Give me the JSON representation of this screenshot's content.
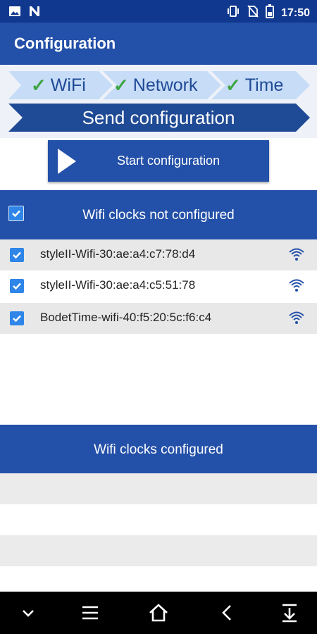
{
  "status_bar": {
    "time": "17:50",
    "icons": [
      "image-icon",
      "n-notification-icon",
      "vibrate-icon",
      "no-sim-icon",
      "battery-icon"
    ]
  },
  "app_bar": {
    "title": "Configuration"
  },
  "steps": [
    {
      "label": "WiFi",
      "done": true
    },
    {
      "label": "Network",
      "done": true
    },
    {
      "label": "Time",
      "done": true
    }
  ],
  "current_step": {
    "label": "Send configuration"
  },
  "start_button": {
    "label": "Start configuration"
  },
  "not_configured": {
    "header": "Wifi clocks not configured",
    "header_checked": true,
    "items": [
      {
        "name": "styleII-Wifi-30:ae:a4:c7:78:d4",
        "checked": true
      },
      {
        "name": "styleII-Wifi-30:ae:a4:c5:51:78",
        "checked": true
      },
      {
        "name": "BodetTime-wifi-40:f5:20:5c:f6:c4",
        "checked": true
      }
    ]
  },
  "configured": {
    "header": "Wifi clocks configured",
    "items": []
  },
  "nav_bar": {
    "buttons": [
      "chevron-down-icon",
      "menu-icon",
      "home-icon",
      "back-icon",
      "download-icon"
    ]
  },
  "colors": {
    "primary": "#2350a8",
    "status_bar": "#10388e",
    "step_light": "#c6dcf7",
    "step_dark": "#1f4a95",
    "check": "#3fa441",
    "checkbox": "#2f86e8",
    "row_alt": "#e8e8e8"
  }
}
